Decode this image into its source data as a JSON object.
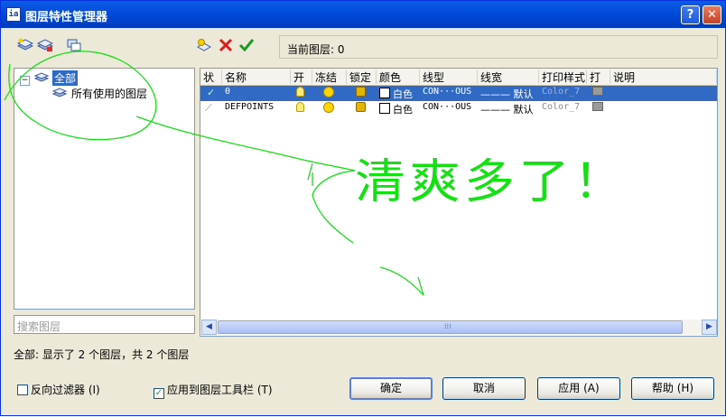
{
  "title": "图层特性管理器",
  "title_icon": "layer-manager-icon",
  "title_buttons": {
    "help": "?",
    "close": "✕"
  },
  "current_layer_label": "当前图层: 0",
  "tree": {
    "root": "全部",
    "child": "所有使用的图层"
  },
  "search_placeholder": "搜索图层",
  "columns": [
    "状",
    "名称",
    "开",
    "冻结",
    "锁定",
    "颜色",
    "线型",
    "线宽",
    "打印样式",
    "打",
    "说明"
  ],
  "layers": [
    {
      "name": "0",
      "color": "白色",
      "linetype": "CON···OUS",
      "lineweight": "——— 默认",
      "plotstyle": "Color_7",
      "selected": true,
      "current": true
    },
    {
      "name": "DEFPOINTS",
      "color": "白色",
      "linetype": "CON···OUS",
      "lineweight": "——— 默认",
      "plotstyle": "Color_7",
      "selected": false,
      "current": false
    }
  ],
  "scroll_grip": "⁞⁞⁞",
  "status_text": "全部: 显示了 2 个图层，共 2 个图层",
  "invert_filter_label": "反向过滤器 (I)",
  "apply_toolbar_label": "应用到图层工具栏 (T)",
  "buttons": {
    "ok": "确定",
    "cancel": "取消",
    "apply": "应用 (A)",
    "help": "帮助 (H)"
  },
  "annotation_text": "清爽多了！",
  "colors": {
    "title_bar": "#0046d5",
    "selection": "#316ac5",
    "annotation": "#14e014"
  }
}
